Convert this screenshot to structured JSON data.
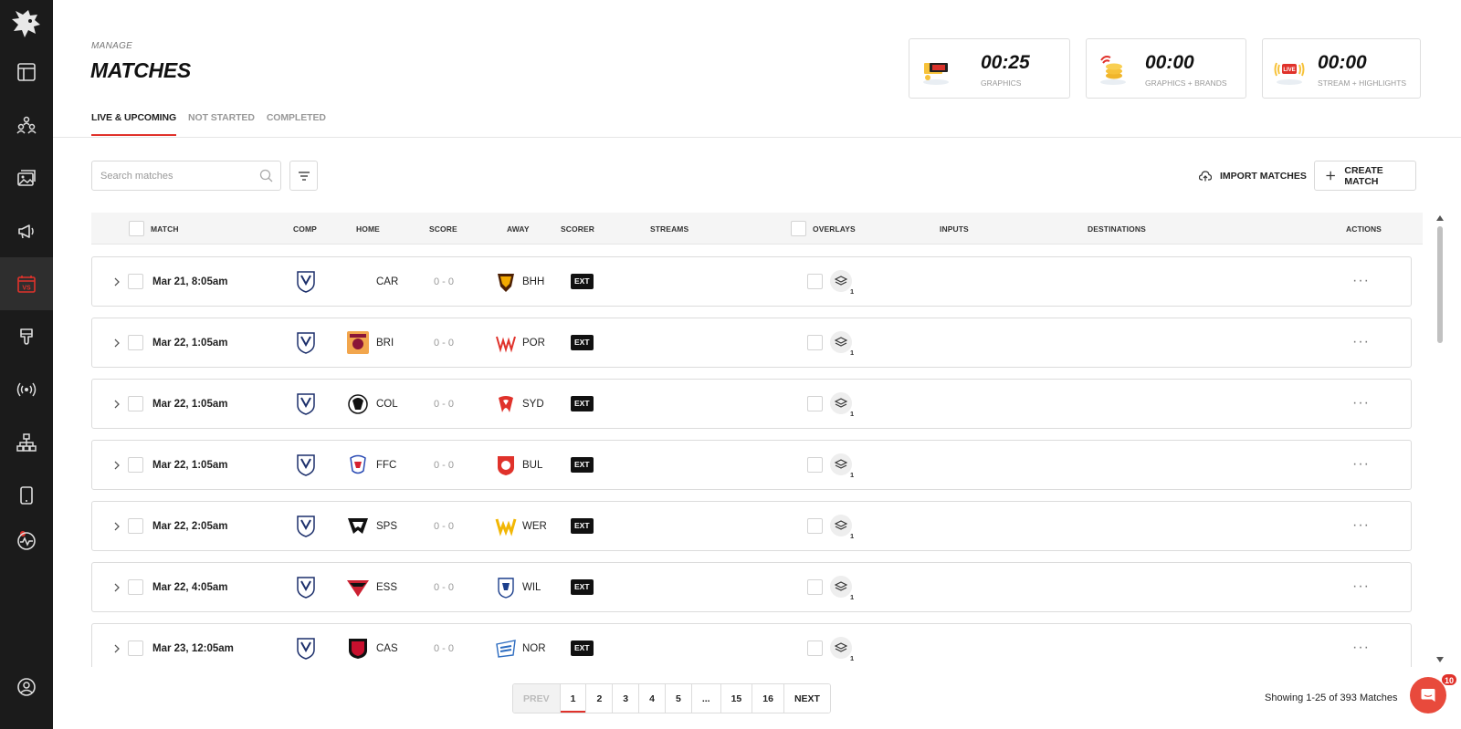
{
  "header": {
    "section": "MANAGE",
    "title": "MATCHES"
  },
  "tabs": [
    {
      "label": "LIVE & UPCOMING",
      "active": true
    },
    {
      "label": "NOT STARTED",
      "active": false
    },
    {
      "label": "COMPLETED",
      "active": false
    }
  ],
  "stats": [
    {
      "time": "00:25",
      "label": "GRAPHICS",
      "icon": "graphics-illustration"
    },
    {
      "time": "00:00",
      "label": "GRAPHICS + BRANDS",
      "icon": "brands-illustration"
    },
    {
      "time": "00:00",
      "label": "STREAM + HIGHLIGHTS",
      "icon": "live-stream-illustration"
    }
  ],
  "toolbar": {
    "search_placeholder": "Search matches",
    "import_label": "IMPORT MATCHES",
    "create_label": "CREATE MATCH"
  },
  "columns": {
    "match": "MATCH",
    "comp": "COMP",
    "home": "HOME",
    "score": "SCORE",
    "away": "AWAY",
    "scorer": "SCORER",
    "streams": "STREAMS",
    "overlays": "OVERLAYS",
    "inputs": "INPUTS",
    "destinations": "DESTINATIONS",
    "actions": "ACTIONS"
  },
  "matches": [
    {
      "date": "Mar 21, 8:05am",
      "home": "CAR",
      "score": "0 - 0",
      "away": "BHH",
      "scorer": "EXT",
      "overlays": "1"
    },
    {
      "date": "Mar 22, 1:05am",
      "home": "BRI",
      "score": "0 - 0",
      "away": "POR",
      "scorer": "EXT",
      "overlays": "1"
    },
    {
      "date": "Mar 22, 1:05am",
      "home": "COL",
      "score": "0 - 0",
      "away": "SYD",
      "scorer": "EXT",
      "overlays": "1"
    },
    {
      "date": "Mar 22, 1:05am",
      "home": "FFC",
      "score": "0 - 0",
      "away": "BUL",
      "scorer": "EXT",
      "overlays": "1"
    },
    {
      "date": "Mar 22, 2:05am",
      "home": "SPS",
      "score": "0 - 0",
      "away": "WER",
      "scorer": "EXT",
      "overlays": "1"
    },
    {
      "date": "Mar 22, 4:05am",
      "home": "ESS",
      "score": "0 - 0",
      "away": "WIL",
      "scorer": "EXT",
      "overlays": "1"
    },
    {
      "date": "Mar 23, 12:05am",
      "home": "CAS",
      "score": "0 - 0",
      "away": "NOR",
      "scorer": "EXT",
      "overlays": "1"
    }
  ],
  "pagination": {
    "prev": "PREV",
    "pages": [
      "1",
      "2",
      "3",
      "4",
      "5",
      "...",
      "15",
      "16"
    ],
    "current": "1",
    "next": "NEXT",
    "summary": "Showing 1-25 of 393 Matches"
  },
  "chat": {
    "badge": "10"
  },
  "colors": {
    "accent": "#e0322b",
    "sidebar": "#1b1b1b"
  }
}
